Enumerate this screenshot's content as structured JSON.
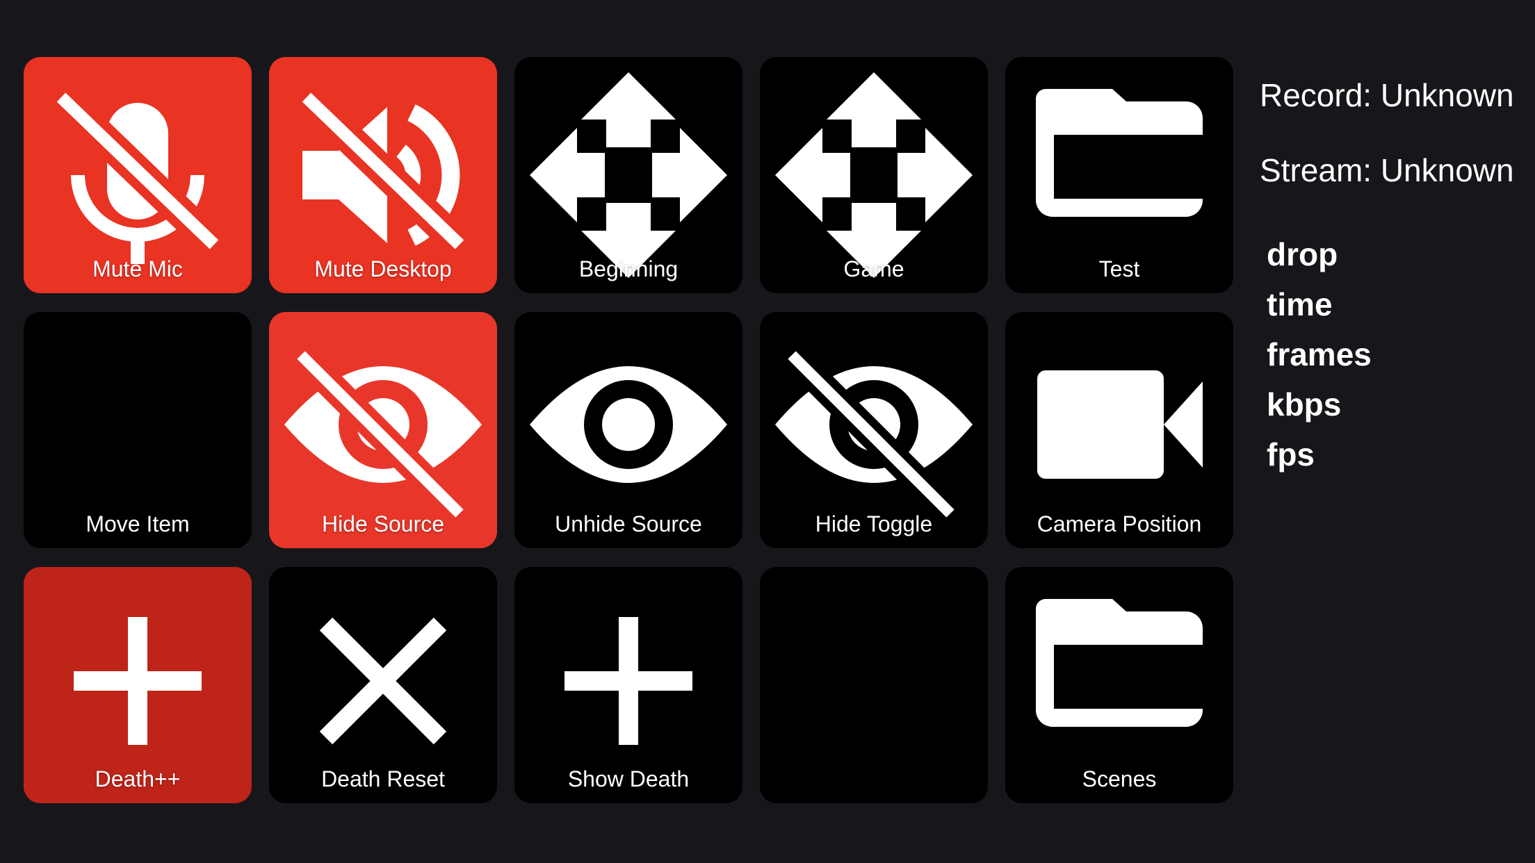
{
  "colors": {
    "background": "#17171b",
    "tile_black": "#000000",
    "tile_red": "#e93323",
    "tile_dark_red": "#bf2419",
    "icon": "#ffffff"
  },
  "tiles": [
    {
      "label": "Mute Mic",
      "icon": "mic-off-icon",
      "color": "red"
    },
    {
      "label": "Mute Desktop",
      "icon": "volume-off-icon",
      "color": "red"
    },
    {
      "label": "Beginning",
      "icon": "move-arrows-icon",
      "color": "black"
    },
    {
      "label": "Game",
      "icon": "move-arrows-icon",
      "color": "black"
    },
    {
      "label": "Test",
      "icon": "folder-icon",
      "color": "black"
    },
    {
      "label": "Move Item",
      "icon": "",
      "color": "black"
    },
    {
      "label": "Hide Source",
      "icon": "eye-off-icon",
      "color": "red"
    },
    {
      "label": "Unhide Source",
      "icon": "eye-icon",
      "color": "black"
    },
    {
      "label": "Hide Toggle",
      "icon": "eye-off-icon",
      "color": "black"
    },
    {
      "label": "Camera Position",
      "icon": "video-camera-icon",
      "color": "black"
    },
    {
      "label": "Death++",
      "icon": "plus-icon",
      "color": "dark-red"
    },
    {
      "label": "Death Reset",
      "icon": "close-x-icon",
      "color": "black"
    },
    {
      "label": "Show Death",
      "icon": "plus-icon",
      "color": "black"
    },
    {
      "label": "",
      "icon": "",
      "color": "black"
    },
    {
      "label": "Scenes",
      "icon": "folder-icon",
      "color": "black"
    }
  ],
  "status": {
    "record": "Record: Unknown",
    "stream": "Stream: Unknown"
  },
  "stats": [
    "drop",
    "time",
    "frames",
    "kbps",
    "fps"
  ]
}
